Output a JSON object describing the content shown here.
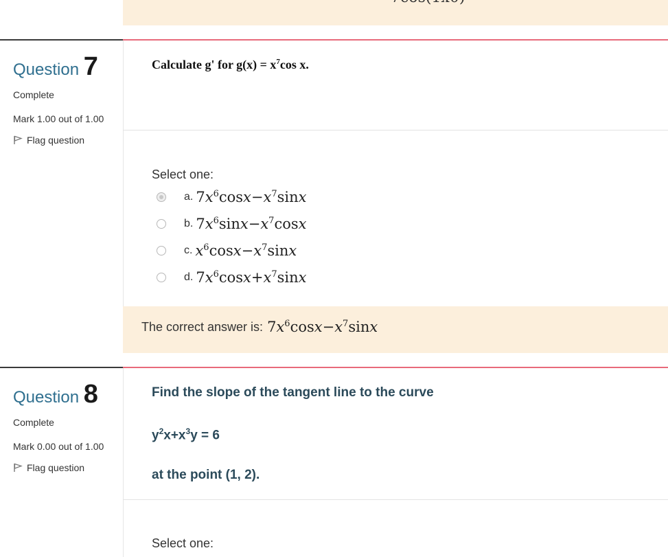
{
  "prev_feedback": {
    "cut_text": "7cos(1x0)"
  },
  "questions": [
    {
      "label": "Question",
      "number": "7",
      "state": "Complete",
      "mark": "Mark 1.00 out of 1.00",
      "flag_label": "Flag question",
      "text_prefix": "Calculate g' for g(x) = x",
      "text_exp": "7",
      "text_suffix": "cos x.",
      "select_label": "Select one:",
      "options": [
        {
          "letter": "a.",
          "coef": "7",
          "v1": "x",
          "e1": "6",
          "f1": "cos",
          "v2": "x",
          "op": "−",
          "v3": "x",
          "e2": "7",
          "f2": "sin",
          "v4": "x",
          "checked": true
        },
        {
          "letter": "b.",
          "coef": "7",
          "v1": "x",
          "e1": "6",
          "f1": "sin",
          "v2": "x",
          "op": "−",
          "v3": "x",
          "e2": "7",
          "f2": "cos",
          "v4": "x",
          "checked": false
        },
        {
          "letter": "c.",
          "coef": "",
          "v1": "x",
          "e1": "6",
          "f1": "cos",
          "v2": "x",
          "op": "−",
          "v3": "x",
          "e2": "7",
          "f2": "sin",
          "v4": "x",
          "checked": false
        },
        {
          "letter": "d.",
          "coef": "7",
          "v1": "x",
          "e1": "6",
          "f1": "cos",
          "v2": "x",
          "op": "+",
          "v3": "x",
          "e2": "7",
          "f2": "sin",
          "v4": "x",
          "checked": false
        }
      ],
      "feedback_label": "The correct answer is:",
      "correct": {
        "coef": "7",
        "v1": "x",
        "e1": "6",
        "f1": "cos",
        "v2": "x",
        "op": "−",
        "v3": "x",
        "e2": "7",
        "f2": "sin",
        "v4": "x"
      }
    },
    {
      "label": "Question",
      "number": "8",
      "state": "Complete",
      "mark": "Mark 0.00 out of 1.00",
      "flag_label": "Flag question",
      "line1": "Find the slope of the tangent line to the curve",
      "eq_y": "y",
      "eq_e1": "2",
      "eq_mid": "x+x",
      "eq_e2": "3",
      "eq_end": "y = 6",
      "line3": "at the point (1, 2).",
      "select_label": "Select one:"
    }
  ]
}
